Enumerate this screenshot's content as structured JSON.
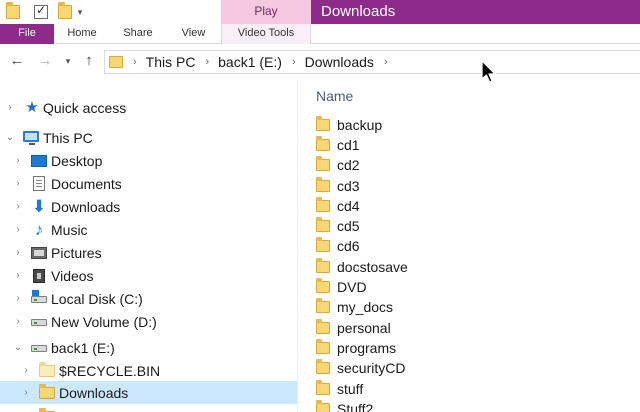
{
  "titlebar": {
    "contextual_tab": "Play",
    "window_title": "Downloads"
  },
  "ribbon": {
    "tabs": [
      "File",
      "Home",
      "Share",
      "View",
      "Video Tools"
    ]
  },
  "address_bar": {
    "segments": [
      "This PC",
      "back1 (E:)",
      "Downloads"
    ]
  },
  "nav_pane": {
    "items": [
      {
        "label": "Quick access",
        "icon": "star-icon",
        "expanded": false,
        "selected": false
      },
      {
        "label": "This PC",
        "icon": "computer-icon",
        "expanded": true,
        "selected": false
      },
      {
        "label": "Desktop",
        "icon": "desktop-icon",
        "expanded": false,
        "selected": false
      },
      {
        "label": "Documents",
        "icon": "documents-icon",
        "expanded": false,
        "selected": false
      },
      {
        "label": "Downloads",
        "icon": "download-arrow-icon",
        "expanded": false,
        "selected": false
      },
      {
        "label": "Music",
        "icon": "music-note-icon",
        "expanded": false,
        "selected": false
      },
      {
        "label": "Pictures",
        "icon": "pictures-icon",
        "expanded": false,
        "selected": false
      },
      {
        "label": "Videos",
        "icon": "videos-icon",
        "expanded": false,
        "selected": false
      },
      {
        "label": "Local Disk (C:)",
        "icon": "windows-drive-icon",
        "expanded": false,
        "selected": false
      },
      {
        "label": "New Volume (D:)",
        "icon": "drive-icon",
        "expanded": false,
        "selected": false
      },
      {
        "label": "back1 (E:)",
        "icon": "drive-icon",
        "expanded": true,
        "selected": false
      },
      {
        "label": "$RECYCLE.BIN",
        "icon": "folder-icon",
        "expanded": false,
        "selected": false
      },
      {
        "label": "Downloads",
        "icon": "folder-icon",
        "expanded": false,
        "selected": true
      }
    ]
  },
  "content": {
    "column_header": "Name",
    "files": [
      "backup",
      "cd1",
      "cd2",
      "cd3",
      "cd4",
      "cd5",
      "cd6",
      "docstosave",
      "DVD",
      "my_docs",
      "personal",
      "programs",
      "securityCD",
      "stuff",
      "Stuff2"
    ]
  },
  "colors": {
    "accent": "#8e2a8a",
    "contextual_tab": "#f6c8e2",
    "selection": "#cce8ff",
    "folder": "#f7d774"
  }
}
